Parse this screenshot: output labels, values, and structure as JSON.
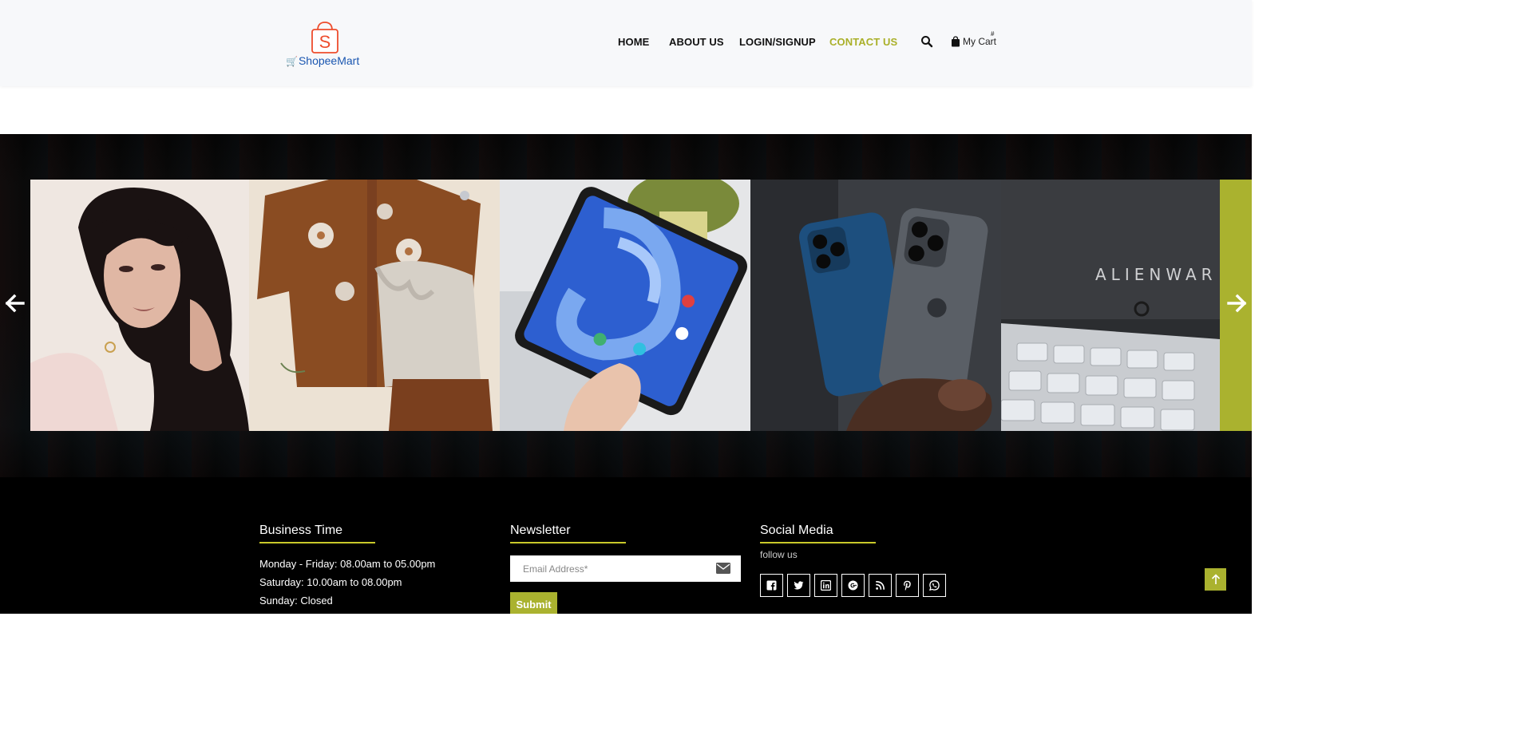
{
  "brand": {
    "logo_text": "ShopeeMart",
    "logo_letter": "S",
    "colors": {
      "logo_orange": "#ee4d2d",
      "logo_blue": "#1a56b0"
    }
  },
  "nav": {
    "items": [
      {
        "label": "HOME",
        "active": false
      },
      {
        "label": "ABOUT US",
        "active": false
      },
      {
        "label": "LOGIN/SIGNUP",
        "active": false
      },
      {
        "label": "CONTACT US",
        "active": true
      }
    ],
    "search_icon": "search-icon",
    "cart": {
      "label": "My Cart",
      "count": "#"
    }
  },
  "gallery": {
    "slides": [
      {
        "subject": "portrait-woman"
      },
      {
        "subject": "knit-sweater-clothing"
      },
      {
        "subject": "tablet-in-hand"
      },
      {
        "subject": "iphone-12-pro"
      },
      {
        "subject": "alienware-laptop",
        "text": "ALIENWAR"
      }
    ],
    "prev_icon": "arrow-left-icon",
    "next_icon": "arrow-right-icon"
  },
  "footer": {
    "business_time": {
      "title": "Business Time",
      "lines": [
        "Monday - Friday: 08.00am to 05.00pm",
        "Saturday: 10.00am to 08.00pm",
        "Sunday: Closed"
      ]
    },
    "newsletter": {
      "title": "Newsletter",
      "email_placeholder": "Email Address*",
      "submit_label": "Submit"
    },
    "social": {
      "title": "Social Media",
      "subtitle": "follow us",
      "icons": [
        "facebook-icon",
        "twitter-icon",
        "linkedin-icon",
        "google-plus-icon",
        "rss-icon",
        "pinterest-icon",
        "whatsapp-icon"
      ]
    }
  },
  "colors": {
    "accent": "#aab22f",
    "underline": "#c9c92a",
    "footer_bg": "#000000",
    "header_bg": "#f7f8fa"
  }
}
